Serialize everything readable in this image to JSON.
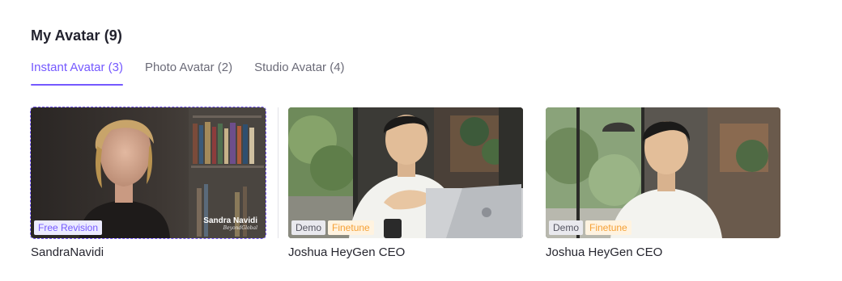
{
  "section": {
    "title": "My Avatar (9)"
  },
  "tabs": [
    {
      "label": "Instant Avatar (3)",
      "active": true
    },
    {
      "label": "Photo Avatar (2)",
      "active": false
    },
    {
      "label": "Studio Avatar (4)",
      "active": false
    }
  ],
  "avatars": [
    {
      "name": "SandraNavidi",
      "selected": true,
      "badges": [
        "Free Revision"
      ],
      "watermark": {
        "title": "Sandra Navidi",
        "subtitle": "BeyondGlobal"
      }
    },
    {
      "name": "Joshua HeyGen CEO",
      "selected": false,
      "badges": [
        "Demo",
        "Finetune"
      ]
    },
    {
      "name": "Joshua HeyGen CEO",
      "selected": false,
      "badges": [
        "Demo",
        "Finetune"
      ]
    }
  ],
  "colors": {
    "accent": "#7559ff",
    "finetune": "#f5a136",
    "text": "#22222e",
    "muted": "#6b6b78"
  },
  "icons": {
    "thumbnail": "video-thumbnail"
  }
}
